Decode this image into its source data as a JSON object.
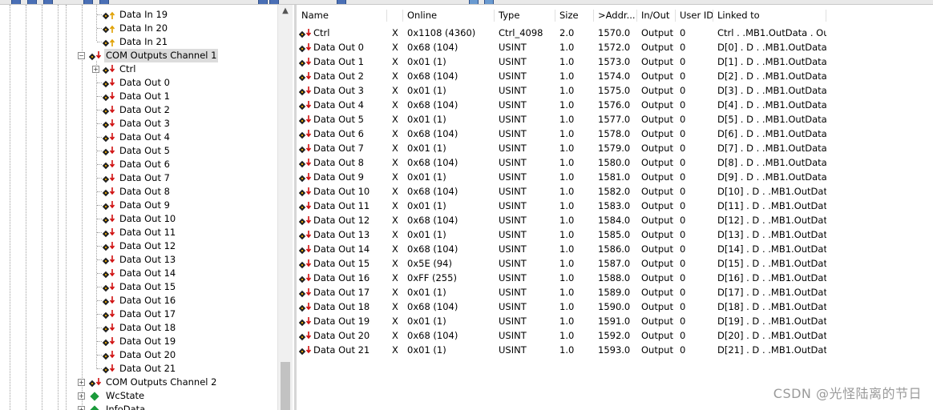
{
  "tree": {
    "items": [
      {
        "label": "Data In 19",
        "kind": "in"
      },
      {
        "label": "Data In 20",
        "kind": "in"
      },
      {
        "label": "Data In 21",
        "kind": "in"
      },
      {
        "label": "COM Outputs Channel 1",
        "kind": "channel",
        "expander": "−"
      },
      {
        "label": "Ctrl",
        "kind": "out",
        "expander": "+"
      },
      {
        "label": "Data Out 0",
        "kind": "out"
      },
      {
        "label": "Data Out 1",
        "kind": "out"
      },
      {
        "label": "Data Out 2",
        "kind": "out"
      },
      {
        "label": "Data Out 3",
        "kind": "out"
      },
      {
        "label": "Data Out 4",
        "kind": "out"
      },
      {
        "label": "Data Out 5",
        "kind": "out"
      },
      {
        "label": "Data Out 6",
        "kind": "out"
      },
      {
        "label": "Data Out 7",
        "kind": "out"
      },
      {
        "label": "Data Out 8",
        "kind": "out"
      },
      {
        "label": "Data Out 9",
        "kind": "out"
      },
      {
        "label": "Data Out 10",
        "kind": "out"
      },
      {
        "label": "Data Out 11",
        "kind": "out"
      },
      {
        "label": "Data Out 12",
        "kind": "out"
      },
      {
        "label": "Data Out 13",
        "kind": "out"
      },
      {
        "label": "Data Out 14",
        "kind": "out"
      },
      {
        "label": "Data Out 15",
        "kind": "out"
      },
      {
        "label": "Data Out 16",
        "kind": "out"
      },
      {
        "label": "Data Out 17",
        "kind": "out"
      },
      {
        "label": "Data Out 18",
        "kind": "out"
      },
      {
        "label": "Data Out 19",
        "kind": "out"
      },
      {
        "label": "Data Out 20",
        "kind": "out"
      },
      {
        "label": "Data Out 21",
        "kind": "out"
      },
      {
        "label": "COM Outputs Channel 2",
        "kind": "channel",
        "expander": "+"
      },
      {
        "label": "WcState",
        "kind": "state",
        "expander": "+"
      },
      {
        "label": "InfoData",
        "kind": "state",
        "expander": "+"
      }
    ]
  },
  "table": {
    "columns": [
      "Name",
      "Online",
      "Type",
      "Size",
      ">Addr...",
      "In/Out",
      "User ID",
      "Linked to"
    ],
    "rows": [
      {
        "name": "Ctrl",
        "x": "X",
        "online": "0x1108 (4360)",
        "type": "Ctrl_4098",
        "size": "2.0",
        "addr": "1570.0",
        "inout": "Output",
        "userid": "0",
        "linked": "Ctrl . .MB1.OutData . Ou..."
      },
      {
        "name": "Data Out 0",
        "x": "X",
        "online": "0x68 (104)",
        "type": "USINT",
        "size": "1.0",
        "addr": "1572.0",
        "inout": "Output",
        "userid": "0",
        "linked": "D[0] . D . .MB1.OutData ...."
      },
      {
        "name": "Data Out 1",
        "x": "X",
        "online": "0x01 (1)",
        "type": "USINT",
        "size": "1.0",
        "addr": "1573.0",
        "inout": "Output",
        "userid": "0",
        "linked": "D[1] . D . .MB1.OutData ...."
      },
      {
        "name": "Data Out 2",
        "x": "X",
        "online": "0x68 (104)",
        "type": "USINT",
        "size": "1.0",
        "addr": "1574.0",
        "inout": "Output",
        "userid": "0",
        "linked": "D[2] . D . .MB1.OutData ...."
      },
      {
        "name": "Data Out 3",
        "x": "X",
        "online": "0x01 (1)",
        "type": "USINT",
        "size": "1.0",
        "addr": "1575.0",
        "inout": "Output",
        "userid": "0",
        "linked": "D[3] . D . .MB1.OutData ...."
      },
      {
        "name": "Data Out 4",
        "x": "X",
        "online": "0x68 (104)",
        "type": "USINT",
        "size": "1.0",
        "addr": "1576.0",
        "inout": "Output",
        "userid": "0",
        "linked": "D[4] . D . .MB1.OutData ...."
      },
      {
        "name": "Data Out 5",
        "x": "X",
        "online": "0x01 (1)",
        "type": "USINT",
        "size": "1.0",
        "addr": "1577.0",
        "inout": "Output",
        "userid": "0",
        "linked": "D[5] . D . .MB1.OutData ...."
      },
      {
        "name": "Data Out 6",
        "x": "X",
        "online": "0x68 (104)",
        "type": "USINT",
        "size": "1.0",
        "addr": "1578.0",
        "inout": "Output",
        "userid": "0",
        "linked": "D[6] . D . .MB1.OutData ...."
      },
      {
        "name": "Data Out 7",
        "x": "X",
        "online": "0x01 (1)",
        "type": "USINT",
        "size": "1.0",
        "addr": "1579.0",
        "inout": "Output",
        "userid": "0",
        "linked": "D[7] . D . .MB1.OutData ...."
      },
      {
        "name": "Data Out 8",
        "x": "X",
        "online": "0x68 (104)",
        "type": "USINT",
        "size": "1.0",
        "addr": "1580.0",
        "inout": "Output",
        "userid": "0",
        "linked": "D[8] . D . .MB1.OutData ...."
      },
      {
        "name": "Data Out 9",
        "x": "X",
        "online": "0x01 (1)",
        "type": "USINT",
        "size": "1.0",
        "addr": "1581.0",
        "inout": "Output",
        "userid": "0",
        "linked": "D[9] . D . .MB1.OutData ...."
      },
      {
        "name": "Data Out 10",
        "x": "X",
        "online": "0x68 (104)",
        "type": "USINT",
        "size": "1.0",
        "addr": "1582.0",
        "inout": "Output",
        "userid": "0",
        "linked": "D[10] . D . .MB1.OutData..."
      },
      {
        "name": "Data Out 11",
        "x": "X",
        "online": "0x01 (1)",
        "type": "USINT",
        "size": "1.0",
        "addr": "1583.0",
        "inout": "Output",
        "userid": "0",
        "linked": "D[11] . D . .MB1.OutData..."
      },
      {
        "name": "Data Out 12",
        "x": "X",
        "online": "0x68 (104)",
        "type": "USINT",
        "size": "1.0",
        "addr": "1584.0",
        "inout": "Output",
        "userid": "0",
        "linked": "D[12] . D . .MB1.OutData..."
      },
      {
        "name": "Data Out 13",
        "x": "X",
        "online": "0x01 (1)",
        "type": "USINT",
        "size": "1.0",
        "addr": "1585.0",
        "inout": "Output",
        "userid": "0",
        "linked": "D[13] . D . .MB1.OutData..."
      },
      {
        "name": "Data Out 14",
        "x": "X",
        "online": "0x68 (104)",
        "type": "USINT",
        "size": "1.0",
        "addr": "1586.0",
        "inout": "Output",
        "userid": "0",
        "linked": "D[14] . D . .MB1.OutData..."
      },
      {
        "name": "Data Out 15",
        "x": "X",
        "online": "0x5E (94)",
        "type": "USINT",
        "size": "1.0",
        "addr": "1587.0",
        "inout": "Output",
        "userid": "0",
        "linked": "D[15] . D . .MB1.OutData..."
      },
      {
        "name": "Data Out 16",
        "x": "X",
        "online": "0xFF (255)",
        "type": "USINT",
        "size": "1.0",
        "addr": "1588.0",
        "inout": "Output",
        "userid": "0",
        "linked": "D[16] . D . .MB1.OutData..."
      },
      {
        "name": "Data Out 17",
        "x": "X",
        "online": "0x01 (1)",
        "type": "USINT",
        "size": "1.0",
        "addr": "1589.0",
        "inout": "Output",
        "userid": "0",
        "linked": "D[17] . D . .MB1.OutData..."
      },
      {
        "name": "Data Out 18",
        "x": "X",
        "online": "0x68 (104)",
        "type": "USINT",
        "size": "1.0",
        "addr": "1590.0",
        "inout": "Output",
        "userid": "0",
        "linked": "D[18] . D . .MB1.OutData..."
      },
      {
        "name": "Data Out 19",
        "x": "X",
        "online": "0x01 (1)",
        "type": "USINT",
        "size": "1.0",
        "addr": "1591.0",
        "inout": "Output",
        "userid": "0",
        "linked": "D[19] . D . .MB1.OutData..."
      },
      {
        "name": "Data Out 20",
        "x": "X",
        "online": "0x68 (104)",
        "type": "USINT",
        "size": "1.0",
        "addr": "1592.0",
        "inout": "Output",
        "userid": "0",
        "linked": "D[20] . D . .MB1.OutData..."
      },
      {
        "name": "Data Out 21",
        "x": "X",
        "online": "0x01 (1)",
        "type": "USINT",
        "size": "1.0",
        "addr": "1593.0",
        "inout": "Output",
        "userid": "0",
        "linked": "D[21] . D . .MB1.OutData..."
      }
    ]
  },
  "watermark": "CSDN @光怪陆离的节日",
  "colors": {
    "output_arrow": "#d01010",
    "input_arrow": "#e0a000",
    "icon_body": "#222222",
    "state_icon": "#1a9a3a"
  }
}
